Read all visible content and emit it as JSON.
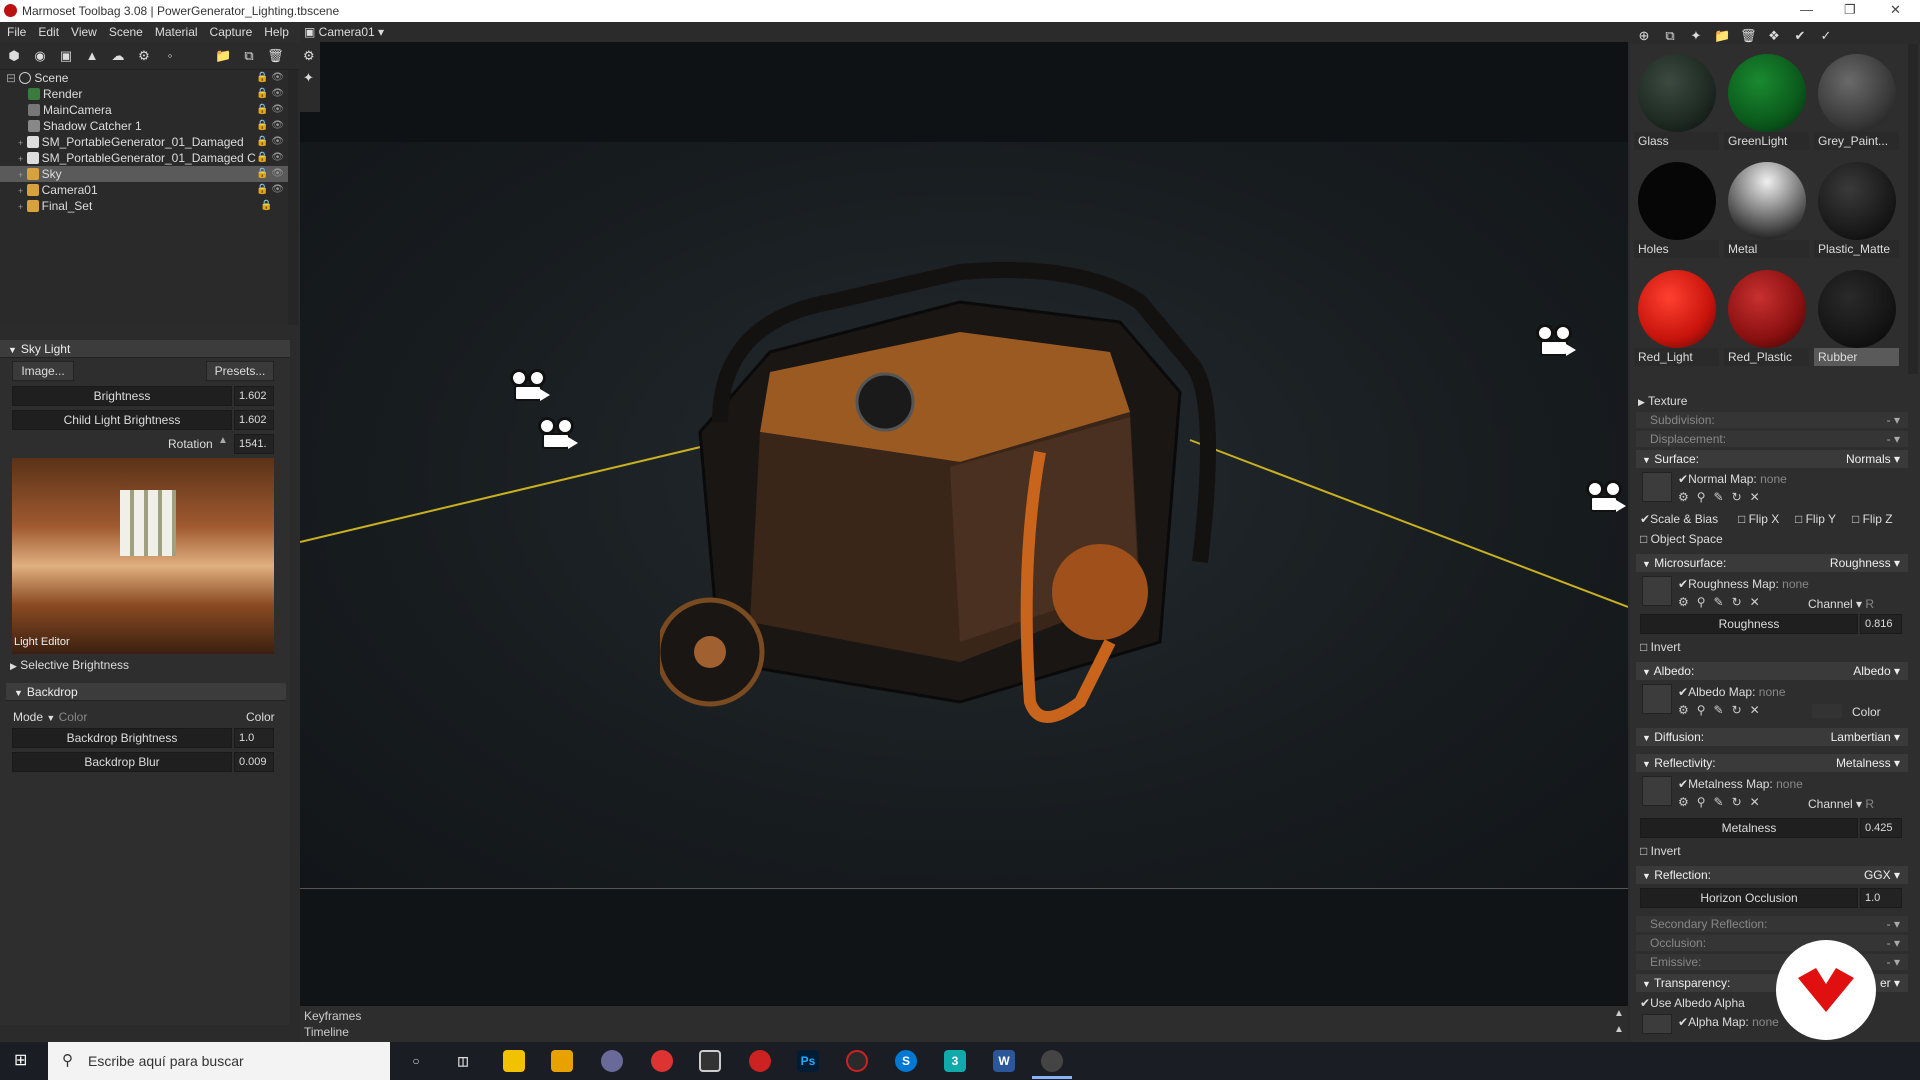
{
  "window": {
    "app": "Marmoset Toolbag 3.08",
    "separator": "|",
    "file": "PowerGenerator_Lighting.tbscene"
  },
  "menu": [
    "File",
    "Edit",
    "View",
    "Scene",
    "Material",
    "Capture",
    "Help"
  ],
  "viewport": {
    "camera_label": "Camera01"
  },
  "scene_tree": [
    {
      "label": "Scene",
      "icon": "scene-icon"
    },
    {
      "label": "Render",
      "icon": "render-icon"
    },
    {
      "label": "MainCamera",
      "icon": "camera-icon"
    },
    {
      "label": "Shadow Catcher 1",
      "icon": "shadow-catcher-icon"
    },
    {
      "label": "SM_PortableGenerator_01_Damaged",
      "icon": "mesh-icon"
    },
    {
      "label": "SM_PortableGenerator_01_Damaged C",
      "icon": "mesh-icon"
    },
    {
      "label": "Sky",
      "icon": "sky-icon",
      "selected": true
    },
    {
      "label": "Camera01",
      "icon": "folder-icon"
    },
    {
      "label": "Final_Set",
      "icon": "folder-icon"
    }
  ],
  "sky_light": {
    "title": "Sky Light",
    "image_button": "Image...",
    "presets_button": "Presets...",
    "brightness_label": "Brightness",
    "brightness": "1.602",
    "child_light_label": "Child Light Brightness",
    "child_light": "1.602",
    "rotation_label": "Rotation",
    "rotation": "1541.",
    "light_editor": "Light Editor",
    "selective_brightness": "Selective Brightness"
  },
  "backdrop": {
    "title": "Backdrop",
    "mode_label": "Mode",
    "mode_value": "Color",
    "mode_right": "Color",
    "brightness_label": "Backdrop Brightness",
    "brightness": "1.0",
    "blur_label": "Backdrop Blur",
    "blur": "0.009"
  },
  "timeline": {
    "keyframes": "Keyframes",
    "timeline": "Timeline"
  },
  "materials": [
    {
      "name": "Glass",
      "color": "#1e2a22"
    },
    {
      "name": "GreenLight",
      "color": "#0b5a1c"
    },
    {
      "name": "Grey_Paint...",
      "color": "#3a3a3a"
    },
    {
      "name": "Holes",
      "color": "#060606"
    },
    {
      "name": "Metal",
      "color": "#9a9a9a"
    },
    {
      "name": "Plastic_Matte",
      "color": "#1a1a1a"
    },
    {
      "name": "Red_Light",
      "color": "#c8140c"
    },
    {
      "name": "Red_Plastic",
      "color": "#8a1010"
    },
    {
      "name": "Rubber",
      "color": "#151515",
      "selected": true
    }
  ],
  "material_props": {
    "texture": "Texture",
    "subdivision": "Subdivision:",
    "subdivision_v": "-",
    "displacement": "Displacement:",
    "displacement_v": "-",
    "surface": "Surface:",
    "surface_v": "Normals",
    "normal_map": "Normal Map:",
    "none": "none",
    "scale_bias": "Scale & Bias",
    "flip_x": "Flip X",
    "flip_y": "Flip Y",
    "flip_z": "Flip Z",
    "object_space": "Object Space",
    "microsurface": "Microsurface:",
    "microsurface_v": "Roughness",
    "roughness_map": "Roughness Map:",
    "channel": "Channel",
    "channel_r": "R",
    "roughness": "Roughness",
    "roughness_v": "0.816",
    "invert": "Invert",
    "albedo": "Albedo:",
    "albedo_v": "Albedo",
    "albedo_map": "Albedo Map:",
    "color": "Color",
    "diffusion": "Diffusion:",
    "diffusion_v": "Lambertian",
    "reflectivity": "Reflectivity:",
    "reflectivity_v": "Metalness",
    "metalness_map": "Metalness Map:",
    "metalness": "Metalness",
    "metalness_v": "0.425",
    "reflection": "Reflection:",
    "reflection_v": "GGX",
    "horizon": "Horizon Occlusion",
    "horizon_v": "1.0",
    "secondary": "Secondary Reflection:",
    "secondary_v": "-",
    "occlusion": "Occlusion:",
    "occlusion_v": "-",
    "emissive": "Emissive:",
    "emissive_v": "-",
    "transparency": "Transparency:",
    "transparency_v": "er",
    "use_albedo_alpha": "Use Albedo Alpha",
    "alpha_map": "Alpha Map:"
  },
  "taskbar": {
    "search_placeholder": "Escribe aquí para buscar"
  }
}
